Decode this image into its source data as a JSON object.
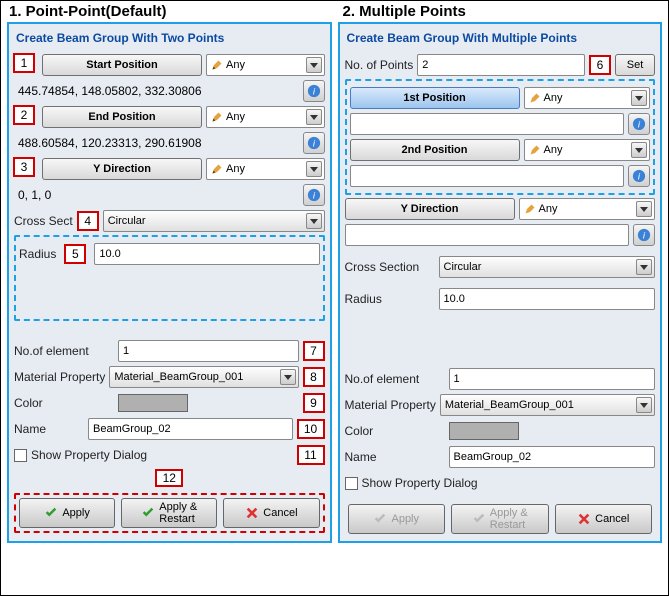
{
  "headings": {
    "left": "1. Point-Point(Default)",
    "right": "2. Multiple Points"
  },
  "left": {
    "title": "Create Beam Group With Two Points",
    "start_btn": "Start Position",
    "any": "Any",
    "start_val": "445.74854, 148.05802, 332.30806",
    "end_btn": "End Position",
    "end_val": "488.60584, 120.23313, 290.61908",
    "ydir_btn": "Y Direction",
    "ydir_val": "0, 1, 0",
    "cross_section_label": "Cross Sect",
    "cross_section_val": "Circular",
    "radius_label": "Radius",
    "radius_val": "10.0",
    "no_elem_label": "No.of element",
    "no_elem_val": "1",
    "mat_label": "Material Property",
    "mat_val": "Material_BeamGroup_001",
    "color_label": "Color",
    "name_label": "Name",
    "name_val": "BeamGroup_02",
    "show_prop": "Show Property Dialog",
    "apply": "Apply",
    "apply_restart": "Apply &\nRestart",
    "cancel": "Cancel"
  },
  "right": {
    "title": "Create Beam Group With Multiple Points",
    "no_points_label": "No. of Points",
    "no_points_val": "2",
    "set_btn": "Set",
    "pos1_btn": "1st Position",
    "pos2_btn": "2nd Position",
    "any": "Any",
    "ydir_btn": "Y Direction",
    "cross_section_label": "Cross Section",
    "cross_section_val": "Circular",
    "radius_label": "Radius",
    "radius_val": "10.0",
    "no_elem_label": "No.of element",
    "no_elem_val": "1",
    "mat_label": "Material Property",
    "mat_val": "Material_BeamGroup_001",
    "color_label": "Color",
    "name_label": "Name",
    "name_val": "BeamGroup_02",
    "show_prop": "Show Property Dialog",
    "apply": "Apply",
    "apply_restart": "Apply &\nRestart",
    "cancel": "Cancel"
  },
  "annotations": [
    "1",
    "2",
    "3",
    "4",
    "5",
    "6",
    "7",
    "8",
    "9",
    "10",
    "11",
    "12"
  ],
  "colors": {
    "accent": "#1ea0e6",
    "red": "#d00000"
  }
}
